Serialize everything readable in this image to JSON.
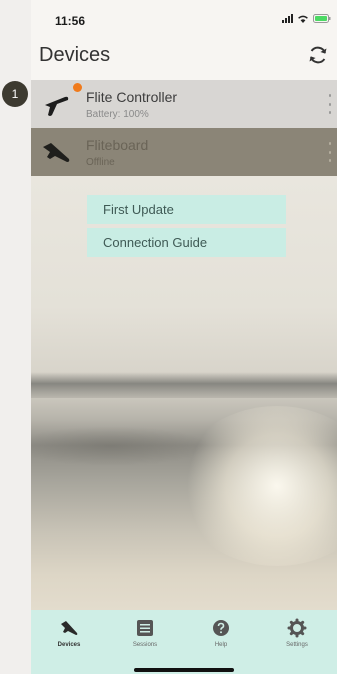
{
  "status_bar": {
    "time": "11:56"
  },
  "header": {
    "title": "Devices"
  },
  "step_badge": "1",
  "devices": [
    {
      "name": "Flite Controller",
      "status": "Battery: 100%"
    },
    {
      "name": "Fliteboard",
      "status": "Offline"
    }
  ],
  "menu": {
    "first_update": "First Update",
    "connection_guide": "Connection Guide"
  },
  "tabs": [
    {
      "label": "Devices",
      "icon": "fliteboard-icon"
    },
    {
      "label": "Sessions",
      "icon": "list-icon"
    },
    {
      "label": "Help",
      "icon": "help-icon"
    },
    {
      "label": "Settings",
      "icon": "gear-icon"
    }
  ],
  "colors": {
    "notify": "#f07b1c",
    "tabbar": "#cfeee6",
    "menu_button": "#c9ede4",
    "offline_row": "#8b8577"
  }
}
